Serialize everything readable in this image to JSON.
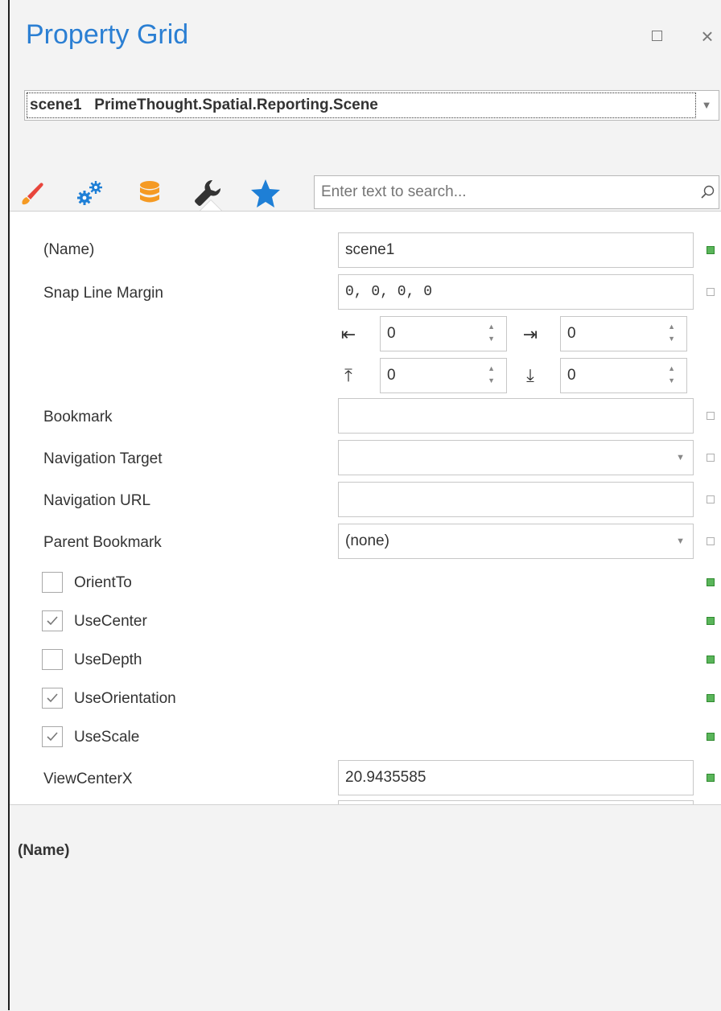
{
  "window": {
    "title": "Property Grid",
    "maximize_icon": "maximize-icon",
    "close_icon": "close-icon",
    "close_glyph": "×"
  },
  "object_selector": {
    "value": "scene1   PrimeThought.Spatial.Reporting.Scene"
  },
  "toolbar": {
    "icons": [
      "brush-icon",
      "gears-icon",
      "database-icon",
      "wrench-icon",
      "star-icon"
    ],
    "search_placeholder": "Enter text to search..."
  },
  "properties": {
    "name": {
      "label": "(Name)",
      "value": "scene1"
    },
    "snap_line_margin": {
      "label": "Snap Line Margin",
      "value": "0, 0, 0, 0",
      "left": "0",
      "right": "0",
      "top": "0",
      "bottom": "0"
    },
    "bookmark": {
      "label": "Bookmark",
      "value": ""
    },
    "navigation_target": {
      "label": "Navigation Target",
      "value": ""
    },
    "navigation_url": {
      "label": "Navigation URL",
      "value": ""
    },
    "parent_bookmark": {
      "label": "Parent Bookmark",
      "value": "(none)"
    },
    "orient_to": {
      "label": "OrientTo",
      "checked": false
    },
    "use_center": {
      "label": "UseCenter",
      "checked": true
    },
    "use_depth": {
      "label": "UseDepth",
      "checked": false
    },
    "use_orientation": {
      "label": "UseOrientation",
      "checked": true
    },
    "use_scale": {
      "label": "UseScale",
      "checked": true
    },
    "view_center_x": {
      "label": "ViewCenterX",
      "value": "20.9435585"
    }
  },
  "description": {
    "title": "(Name)"
  },
  "colors": {
    "accent": "#2b7fd3",
    "modified_marker": "#5ab55a",
    "brush": "#e8453c",
    "database": "#f59a23",
    "star": "#1e7fd6"
  }
}
